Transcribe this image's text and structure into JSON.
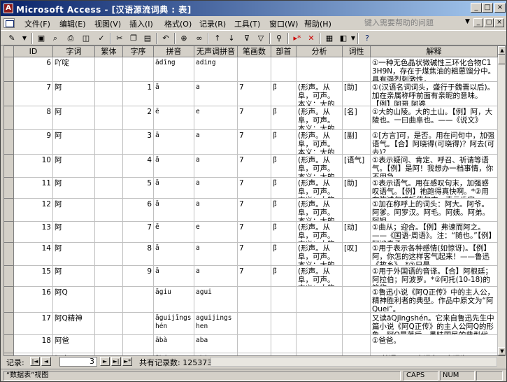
{
  "window": {
    "title": "Microsoft Access - [汉语源流词典 : 表]",
    "app_icon": "access-key-icon",
    "controls": [
      "_",
      "□",
      "×"
    ]
  },
  "menu": {
    "items": [
      "文件(F)",
      "编辑(E)",
      "视图(V)",
      "插入(I)",
      "格式(O)",
      "记录(R)",
      "工具(T)",
      "窗口(W)",
      "帮助(H)"
    ],
    "help_placeholder": "键入需要帮助的问题",
    "mdi_controls": [
      "_",
      "□",
      "×"
    ]
  },
  "toolbar": {
    "icons": [
      "view-design-icon",
      "save-icon",
      "search-file-icon",
      "print-icon",
      "print-preview-icon",
      "spelling-icon",
      "cut-icon",
      "copy-icon",
      "paste-icon",
      "undo-icon",
      "insert-hyperlink-icon",
      "sort-asc-icon",
      "sort-desc-icon",
      "filter-selection-icon",
      "filter-form-icon",
      "apply-filter-icon",
      "find-icon",
      "new-record-icon",
      "delete-record-icon",
      "database-window-icon",
      "new-object-icon",
      "help-icon"
    ]
  },
  "table": {
    "columns": [
      "ID",
      "字词",
      "繁体",
      "字序",
      "拼音",
      "无声调拼音",
      "笔画数",
      "部首",
      "分析",
      "词性",
      "解释"
    ],
    "rows": [
      {
        "id": "6",
        "word": "吖啶",
        "trad": "",
        "order": "",
        "pinyin": "ādīng",
        "toneless": "ading",
        "strokes": "",
        "radical": "",
        "analysis": "",
        "pos": "",
        "explain": "①一种无色晶状微碱性三环化合物C13H9N，存在于煤焦油的粗蒽馏分中。具有强烈刺激性，"
      },
      {
        "id": "7",
        "word": "阿",
        "trad": "",
        "order": "1",
        "pinyin": "ā",
        "toneless": "a",
        "strokes": "7",
        "radical": "阝",
        "analysis": "(形声。从阜，可声。本义：大的",
        "pos": "[助]",
        "explain": "①(汉语名词词头，盛行于魏晋以后)。加在亲属称呼前面有亲昵的意味。【例】阿哥 阿婆"
      },
      {
        "id": "8",
        "word": "阿",
        "trad": "",
        "order": "2",
        "pinyin": "ē",
        "toneless": "e",
        "strokes": "7",
        "radical": "阝",
        "analysis": "(形声。从阜，可声。本义：大的",
        "pos": "[名]",
        "explain": "①大的山陵。大的土山。【例】阿，大陵也。一曰曲阜也。——《说文》"
      },
      {
        "id": "9",
        "word": "阿",
        "trad": "",
        "order": "3",
        "pinyin": "ā",
        "toneless": "a",
        "strokes": "7",
        "radical": "阝",
        "analysis": "(形声。从阜，可声。本义：大的",
        "pos": "[副]",
        "explain": "①[方言]可，是否。用在问句中，加强语气。【合】阿晓得(可晓得)？阿去(可去)？"
      },
      {
        "id": "10",
        "word": "阿",
        "trad": "",
        "order": "4",
        "pinyin": "ā",
        "toneless": "a",
        "strokes": "7",
        "radical": "阝",
        "analysis": "(形声。从阜，可声。本义：大的",
        "pos": "[语气]",
        "explain": "①表示疑问、肯定、呼召、祈请等语气。【例】是阿！我想办一档事情，你不用急。"
      },
      {
        "id": "11",
        "word": "阿",
        "trad": "",
        "order": "5",
        "pinyin": "ā",
        "toneless": "a",
        "strokes": "7",
        "radical": "阝",
        "analysis": "(形声。从阜，可声。本义：大的",
        "pos": "[助]",
        "explain": "①表示语气。用在感叹句末，加强感叹语气。【例】祂跑得真快啊。*②用在陈述句或祈使句末，表示肯定。"
      },
      {
        "id": "12",
        "word": "阿",
        "trad": "",
        "order": "6",
        "pinyin": "ā",
        "toneless": "a",
        "strokes": "7",
        "radical": "阝",
        "analysis": "(形声。从阜，可声。本义：大的",
        "pos": "",
        "explain": "①加在称呼上的词头：阿大。阿爷。阿爹。阿罗汉。阿毛。阿姨。阿弟。阿姐。"
      },
      {
        "id": "13",
        "word": "阿",
        "trad": "",
        "order": "7",
        "pinyin": "ē",
        "toneless": "e",
        "strokes": "7",
        "radical": "阝",
        "analysis": "(形声。从阜，可声。本义：大的",
        "pos": "[动]",
        "explain": "①曲从；迎合。【例】弗谏而阿之。——《国语·周语》。注：“随也。”【例】阿谀奉承"
      },
      {
        "id": "14",
        "word": "阿",
        "trad": "",
        "order": "8",
        "pinyin": "ā",
        "toneless": "a",
        "strokes": "7",
        "radical": "阝",
        "analysis": "(形声。从阜，可声。本义：大的",
        "pos": "[叹]",
        "explain": "①用于表示各种感情(如惊讶)。【例】阿，你怎的这样客气起来！——鲁迅《故乡》。*②只是。"
      },
      {
        "id": "15",
        "word": "阿",
        "trad": "",
        "order": "9",
        "pinyin": "ā",
        "toneless": "a",
        "strokes": "7",
        "radical": "阝",
        "analysis": "(形声。从阜，可声。本义：大的",
        "pos": "",
        "explain": "①用于外国语的音译。【合】阿根廷；阿拉伯；阿波罗。*②阿托(10-18)的简称。"
      },
      {
        "id": "16",
        "word": "阿Q",
        "trad": "",
        "order": "",
        "pinyin": "āgiu",
        "toneless": "agui",
        "strokes": "",
        "radical": "",
        "analysis": "",
        "pos": "",
        "explain": "①鲁迅小说《阿Q正传》中的主人公，精神胜利者的典型。作品中原文为“阿Quei”。"
      },
      {
        "id": "17",
        "word": "阿Q精神",
        "trad": "",
        "order": "",
        "pinyin": "āguijīngshén",
        "toneless": "aguijingshen",
        "strokes": "",
        "radical": "",
        "analysis": "",
        "pos": "",
        "explain": "又读āQjīngshén。它来自鲁迅先生中篇小说《阿Q正传》的主人公阿Q的形象。阿Q是落后、愚昧国民的典型代表。"
      },
      {
        "id": "18",
        "word": "阿爸",
        "trad": "",
        "order": "",
        "pinyin": "ābà",
        "toneless": "aba",
        "strokes": "",
        "radical": "",
        "analysis": "",
        "pos": "",
        "explain": "①爸爸。"
      },
      {
        "id": "19",
        "word": "阿鼻",
        "trad": "",
        "order": "",
        "pinyin": "ābí",
        "toneless": "abi",
        "strokes": "",
        "radical": "",
        "analysis": "",
        "pos": "",
        "explain": "①(梵语Avici)音译名。意译为“无间”。"
      }
    ]
  },
  "navigator": {
    "label": "记录:",
    "current": "3",
    "total_label": "共有记录数: 125373",
    "buttons": [
      "|◄",
      "◄",
      "►",
      "►|",
      "►*"
    ]
  },
  "status": {
    "view": "“数据表”视图",
    "caps": "CAPS",
    "num": "NUM"
  }
}
